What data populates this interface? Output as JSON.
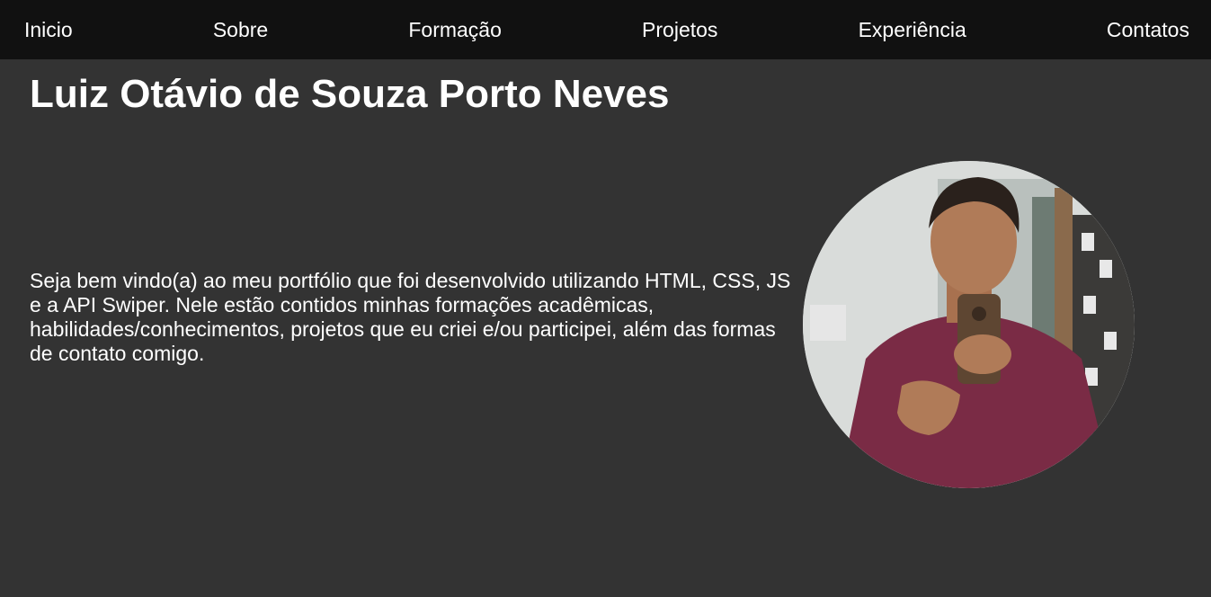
{
  "nav": {
    "items": [
      {
        "label": "Inicio"
      },
      {
        "label": "Sobre"
      },
      {
        "label": "Formação"
      },
      {
        "label": "Projetos"
      },
      {
        "label": "Experiência"
      },
      {
        "label": "Contatos"
      }
    ]
  },
  "hero": {
    "title": "Luiz Otávio de Souza Porto Neves",
    "intro": "Seja bem vindo(a) ao meu portfólio que foi desenvolvido utilizando HTML, CSS, JS e a API Swiper. Nele estão contidos minhas formações acadêmicas, habilidades/conhecimentos, projetos que eu criei e/ou participei, além das formas de contato comigo."
  },
  "colors": {
    "navbar_bg": "#111111",
    "page_bg": "#333333",
    "text": "#ffffff"
  }
}
